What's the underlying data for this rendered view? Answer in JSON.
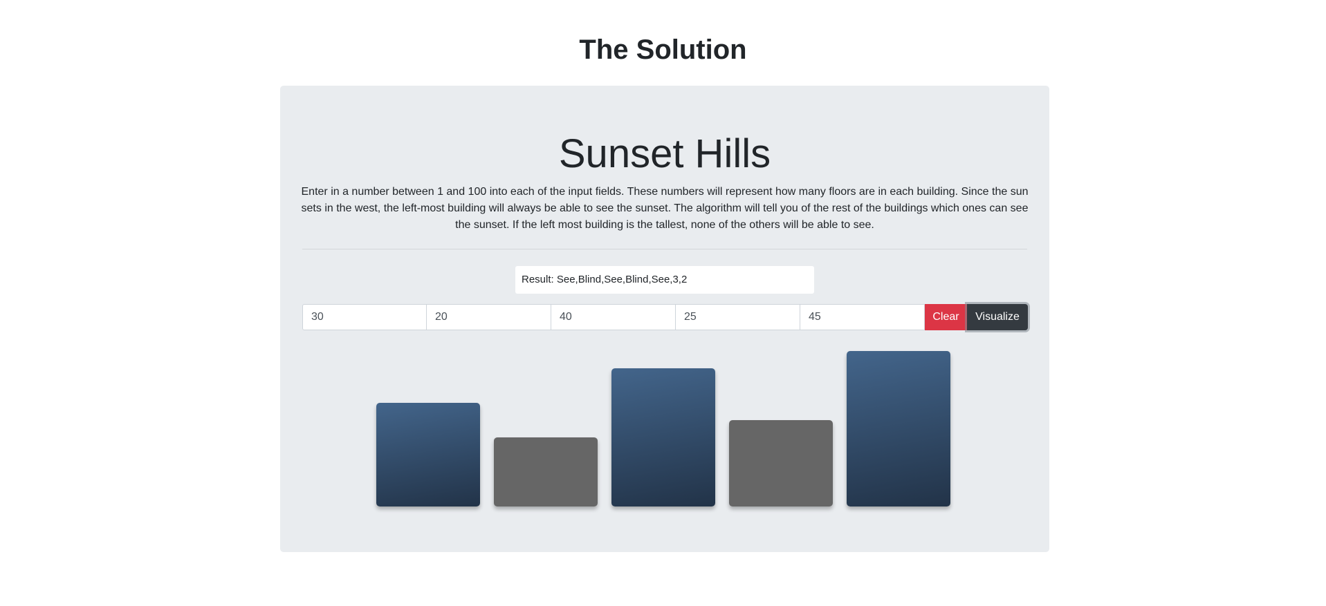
{
  "page": {
    "heading": "The Solution"
  },
  "jumbotron": {
    "title": "Sunset Hills",
    "description": "Enter in a number between 1 and 100 into each of the input fields. These numbers will represent how many floors are in each building. Since the sun sets in the west, the left-most building will always be able to see the sunset. The algorithm will tell you of the rest of the buildings which ones can see the sunset. If the left most building is the tallest, none of the others will be able to see."
  },
  "result": {
    "text": "Result: See,Blind,See,Blind,See,3,2"
  },
  "inputs": [
    {
      "value": "30"
    },
    {
      "value": "20"
    },
    {
      "value": "40"
    },
    {
      "value": "25"
    },
    {
      "value": "45"
    }
  ],
  "buttons": {
    "clear_label": "Clear",
    "visualize_label": "Visualize"
  },
  "colors": {
    "clear_button": "#dc3545",
    "visualize_button": "#343a40",
    "see_building_top": "#43658b",
    "see_building_bottom": "#223348",
    "blind_building": "#666666"
  },
  "buildings": [
    {
      "floors": 30,
      "status": "See"
    },
    {
      "floors": 20,
      "status": "Blind"
    },
    {
      "floors": 40,
      "status": "See"
    },
    {
      "floors": 25,
      "status": "Blind"
    },
    {
      "floors": 45,
      "status": "See"
    }
  ]
}
